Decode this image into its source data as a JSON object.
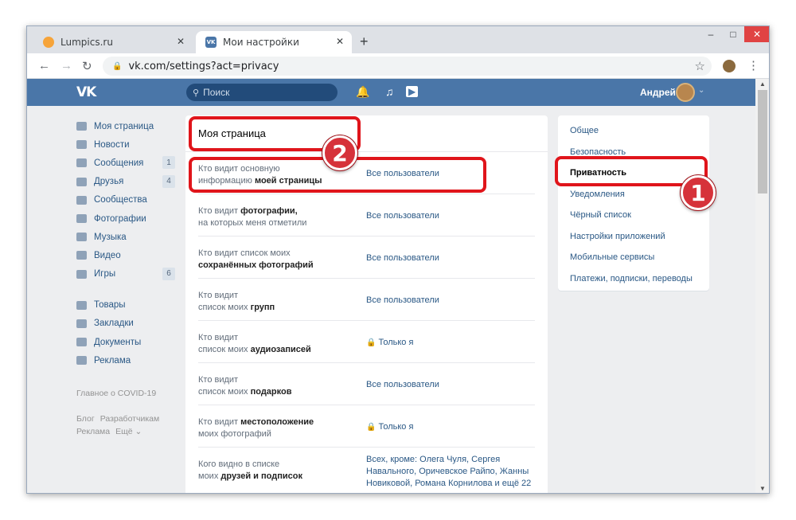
{
  "browser": {
    "tabs": [
      {
        "title": "Lumpics.ru",
        "active": false
      },
      {
        "title": "Мои настройки",
        "active": true
      }
    ],
    "url": "vk.com/settings?act=privacy"
  },
  "header": {
    "logo": "VK",
    "search_placeholder": "Поиск",
    "user_name": "Андрей"
  },
  "left_nav": {
    "items": [
      {
        "label": "Моя страница",
        "count": ""
      },
      {
        "label": "Новости",
        "count": ""
      },
      {
        "label": "Сообщения",
        "count": "1"
      },
      {
        "label": "Друзья",
        "count": "4"
      },
      {
        "label": "Сообщества",
        "count": ""
      },
      {
        "label": "Фотографии",
        "count": ""
      },
      {
        "label": "Музыка",
        "count": ""
      },
      {
        "label": "Видео",
        "count": ""
      },
      {
        "label": "Игры",
        "count": "6"
      }
    ],
    "items2": [
      {
        "label": "Товары"
      },
      {
        "label": "Закладки"
      },
      {
        "label": "Документы"
      },
      {
        "label": "Реклама"
      }
    ],
    "covid": "Главное о COVID-19",
    "footer": [
      "Блог",
      "Разработчикам",
      "Реклама",
      "Ещё ⌄"
    ]
  },
  "main": {
    "title": "Моя страница",
    "rows": [
      {
        "q1": "Кто видит основную",
        "q2": "информацию",
        "q2b": "моей страницы",
        "a": "Все пользователи",
        "locked": false
      },
      {
        "q1": "Кто видит",
        "q1b": "фотографии,",
        "q2": "на которых меня отметили",
        "a": "Все пользователи",
        "locked": false
      },
      {
        "q1": "Кто видит список моих",
        "q2b": "сохранённых фотографий",
        "a": "Все пользователи",
        "locked": false
      },
      {
        "q1": "Кто видит",
        "q2": "список моих",
        "q2b": "групп",
        "a": "Все пользователи",
        "locked": false
      },
      {
        "q1": "Кто видит",
        "q2": "список моих",
        "q2b": "аудиозаписей",
        "a": "Только я",
        "locked": true
      },
      {
        "q1": "Кто видит",
        "q2": "список моих",
        "q2b": "подарков",
        "a": "Все пользователи",
        "locked": false
      },
      {
        "q1": "Кто видит",
        "q1b": "местоположение",
        "q2": "моих фотографий",
        "a": "Только я",
        "locked": true
      },
      {
        "q1": "Кого видно в списке",
        "q2": "моих",
        "q2b": "друзей и подписок",
        "a": "Всех, кроме: Олега Чуля, Сергея Навального, Оричевское Райпо, Жанны Новиковой, Романа Корнилова и ещё 22",
        "locked": false
      }
    ]
  },
  "right_nav": {
    "items": [
      "Общее",
      "Безопасность",
      "Приватность",
      "Уведомления",
      "Чёрный список",
      "Настройки приложений",
      "Мобильные сервисы",
      "Платежи, подписки, переводы"
    ],
    "active_index": 2
  },
  "annotations": {
    "badge1": "1",
    "badge2": "2"
  }
}
